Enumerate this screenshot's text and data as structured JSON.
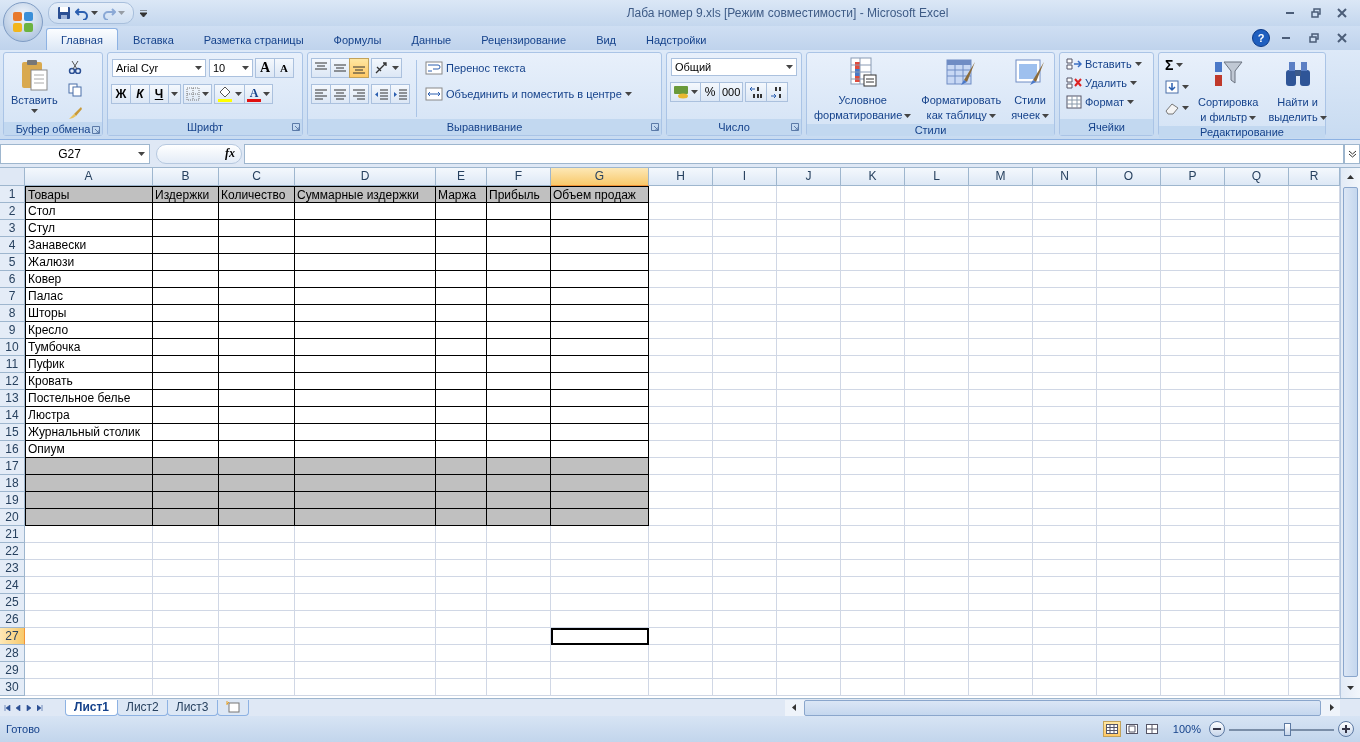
{
  "title_bar": {
    "title": "Лаба номер 9.xls  [Режим совместимости] - Microsoft Excel",
    "redo": {
      "disabled": true
    }
  },
  "ribbon_tabs": [
    {
      "label": "Главная",
      "selected": true
    },
    {
      "label": "Вставка",
      "selected": false
    },
    {
      "label": "Разметка страницы",
      "selected": false
    },
    {
      "label": "Формулы",
      "selected": false
    },
    {
      "label": "Данные",
      "selected": false
    },
    {
      "label": "Рецензирование",
      "selected": false
    },
    {
      "label": "Вид",
      "selected": false
    },
    {
      "label": "Надстройки",
      "selected": false
    }
  ],
  "help": "?",
  "ribbon": {
    "clipboard": {
      "title": "Буфер обмена",
      "launcher": true,
      "paste": "Вставить"
    },
    "font": {
      "title": "Шрифт",
      "launcher": true,
      "font_name": "Arial Cyr",
      "font_size": "10",
      "grow": "A",
      "shrink": "A",
      "bold": "Ж",
      "italic": "К",
      "underline": "Ч",
      "font_color": "A"
    },
    "alignment": {
      "title": "Выравнивание",
      "launcher": true,
      "vertical_align": [
        {
          "selected": false
        },
        {
          "selected": false
        },
        {
          "selected": true
        }
      ],
      "wrap_text": "Перенос текста",
      "merge_center": "Объединить и поместить в центре"
    },
    "number": {
      "title": "Число",
      "launcher": true,
      "format": "Общий",
      "percent": "%",
      "thousands": "000"
    },
    "styles": {
      "title": "Стили",
      "launcher": false,
      "buttons": [
        {
          "kind": "conditional",
          "lines": [
            "Условное",
            "форматирование"
          ]
        },
        {
          "kind": "table",
          "lines": [
            "Форматировать",
            "как таблицу"
          ]
        },
        {
          "kind": "cellstyle",
          "lines": [
            "Стили",
            "ячеек"
          ]
        }
      ]
    },
    "cells": {
      "title": "Ячейки",
      "launcher": false,
      "buttons": [
        {
          "kind": "insert",
          "label": "Вставить"
        },
        {
          "kind": "delete",
          "label": "Удалить"
        },
        {
          "kind": "format",
          "label": "Формат"
        }
      ]
    },
    "editing": {
      "title": "Редактирование",
      "launcher": false,
      "autosum": "Σ",
      "buttons": [
        {
          "kind": "sort",
          "lines": [
            "Сортировка",
            "и фильтр"
          ]
        },
        {
          "kind": "find",
          "lines": [
            "Найти и",
            "выделить"
          ]
        }
      ]
    }
  },
  "formula_bar": {
    "name_box": "G27",
    "fx": "fx"
  },
  "sheet": {
    "columns": [
      {
        "label": "A",
        "selected": false
      },
      {
        "label": "B",
        "selected": false
      },
      {
        "label": "C",
        "selected": false
      },
      {
        "label": "D",
        "selected": false
      },
      {
        "label": "E",
        "selected": false
      },
      {
        "label": "F",
        "selected": false
      },
      {
        "label": "G",
        "selected": true
      },
      {
        "label": "H",
        "selected": false
      },
      {
        "label": "I",
        "selected": false
      },
      {
        "label": "J",
        "selected": false
      },
      {
        "label": "K",
        "selected": false
      },
      {
        "label": "L",
        "selected": false
      },
      {
        "label": "M",
        "selected": false
      },
      {
        "label": "N",
        "selected": false
      },
      {
        "label": "O",
        "selected": false
      },
      {
        "label": "P",
        "selected": false
      },
      {
        "label": "Q",
        "selected": false
      },
      {
        "label": "R",
        "selected": false
      }
    ],
    "rows": [
      {
        "number": "1",
        "cells": [
          "Товары",
          "Издержки",
          "Количество",
          "Суммарные издержки",
          "Маржа",
          "Прибыль",
          "Объем продаж"
        ],
        "shaded": true,
        "bordered": true,
        "selected": false
      },
      {
        "number": "2",
        "cells": [
          "Стол"
        ],
        "shaded": false,
        "bordered": true,
        "selected": false
      },
      {
        "number": "3",
        "cells": [
          "Стул"
        ],
        "shaded": false,
        "bordered": true,
        "selected": false
      },
      {
        "number": "4",
        "cells": [
          "Занавески"
        ],
        "shaded": false,
        "bordered": true,
        "selected": false
      },
      {
        "number": "5",
        "cells": [
          "Жалюзи"
        ],
        "shaded": false,
        "bordered": true,
        "selected": false
      },
      {
        "number": "6",
        "cells": [
          "Ковер"
        ],
        "shaded": false,
        "bordered": true,
        "selected": false
      },
      {
        "number": "7",
        "cells": [
          "Палас"
        ],
        "shaded": false,
        "bordered": true,
        "selected": false
      },
      {
        "number": "8",
        "cells": [
          "Шторы"
        ],
        "shaded": false,
        "bordered": true,
        "selected": false
      },
      {
        "number": "9",
        "cells": [
          "Кресло"
        ],
        "shaded": false,
        "bordered": true,
        "selected": false
      },
      {
        "number": "10",
        "cells": [
          "Тумбочка"
        ],
        "shaded": false,
        "bordered": true,
        "selected": false
      },
      {
        "number": "11",
        "cells": [
          "Пуфик"
        ],
        "shaded": false,
        "bordered": true,
        "selected": false
      },
      {
        "number": "12",
        "cells": [
          "Кровать"
        ],
        "shaded": false,
        "bordered": true,
        "selected": false
      },
      {
        "number": "13",
        "cells": [
          "Постельное белье"
        ],
        "shaded": false,
        "bordered": true,
        "selected": false
      },
      {
        "number": "14",
        "cells": [
          "Люстра"
        ],
        "shaded": false,
        "bordered": true,
        "selected": false
      },
      {
        "number": "15",
        "cells": [
          "Журнальный столик"
        ],
        "shaded": false,
        "bordered": true,
        "selected": false
      },
      {
        "number": "16",
        "cells": [
          "Опиум"
        ],
        "shaded": false,
        "bordered": true,
        "selected": false
      },
      {
        "number": "17",
        "shaded": true,
        "bordered": true,
        "selected": false
      },
      {
        "number": "18",
        "shaded": true,
        "bordered": true,
        "selected": false
      },
      {
        "number": "19",
        "shaded": true,
        "bordered": true,
        "selected": false
      },
      {
        "number": "20",
        "shaded": true,
        "bordered": true,
        "selected": false
      },
      {
        "number": "21",
        "shaded": false,
        "bordered": false,
        "selected": false
      },
      {
        "number": "22",
        "shaded": false,
        "bordered": false,
        "selected": false
      },
      {
        "number": "23",
        "shaded": false,
        "bordered": false,
        "selected": false
      },
      {
        "number": "24",
        "shaded": false,
        "bordered": false,
        "selected": false
      },
      {
        "number": "25",
        "shaded": false,
        "bordered": false,
        "selected": false
      },
      {
        "number": "26",
        "shaded": false,
        "bordered": false,
        "selected": false
      },
      {
        "number": "27",
        "shaded": false,
        "bordered": false,
        "selected": true
      },
      {
        "number": "28",
        "shaded": false,
        "bordered": false,
        "selected": false
      },
      {
        "number": "29",
        "shaded": false,
        "bordered": false,
        "selected": false
      },
      {
        "number": "30",
        "shaded": false,
        "bordered": false,
        "selected": false
      }
    ]
  },
  "sheet_tabs": [
    {
      "label": "Лист1",
      "selected": true
    },
    {
      "label": "Лист2",
      "selected": false
    },
    {
      "label": "Лист3",
      "selected": false
    }
  ],
  "status_bar": {
    "status": "Готово",
    "views": [
      {
        "selected": true
      },
      {
        "selected": false
      },
      {
        "selected": false
      }
    ],
    "zoom": "100%",
    "zoom_slider": {
      "level": 0.55
    }
  }
}
